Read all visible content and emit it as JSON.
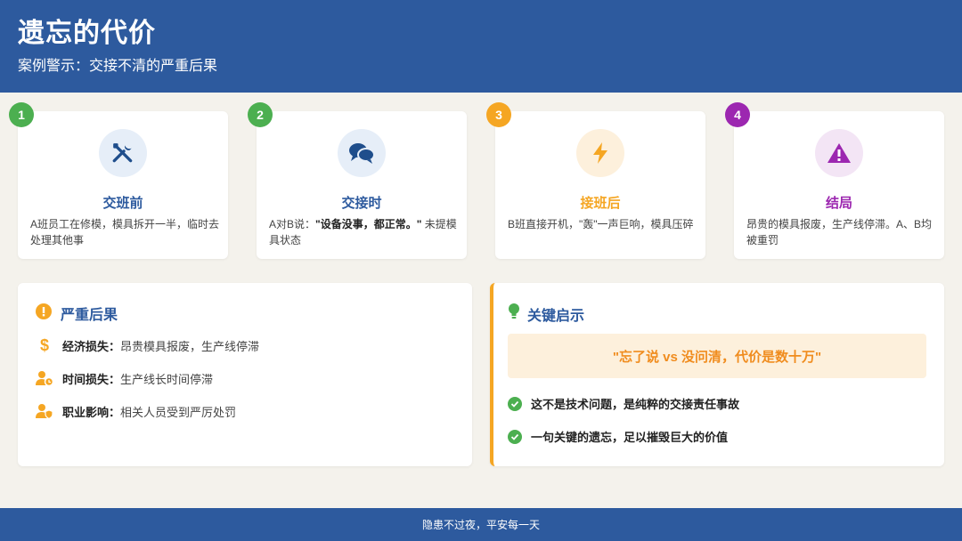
{
  "header": {
    "title": "遗忘的代价",
    "subtitle": "案例警示：交接不清的严重后果"
  },
  "steps": [
    {
      "num": "1",
      "title": "交班前",
      "desc": "A班员工在修模，模具拆开一半，临时去处理其他事",
      "color": "#4caf50",
      "icon": "tools-icon",
      "icon_bg": "#e6eef8"
    },
    {
      "num": "2",
      "title": "交接时",
      "desc_pre": "A对B说：",
      "desc_bold": "\"设备没事，都正常。\"",
      "desc_post": " 未提模具状态",
      "color": "#4caf50",
      "icon": "chat-bubbles-icon",
      "icon_bg": "#e6eef8"
    },
    {
      "num": "3",
      "title": "接班后",
      "desc": "B班直接开机，\"轰\"一声巨响，模具压碎",
      "color": "#f5a623",
      "icon": "lightning-icon",
      "icon_bg": "#fdf0dc"
    },
    {
      "num": "4",
      "title": "结局",
      "desc": "昂贵的模具报废，生产线停滞。A、B均被重罚",
      "color": "#9c27b0",
      "icon": "warning-icon",
      "icon_bg": "#f3e5f5"
    }
  ],
  "consequences": {
    "title": "严重后果",
    "items": [
      {
        "label": "经济损失：",
        "text": "昂贵模具报废，生产线停滞",
        "icon": "dollar-icon"
      },
      {
        "label": "时间损失：",
        "text": "生产线长时间停滞",
        "icon": "user-clock-icon"
      },
      {
        "label": "职业影响：",
        "text": "相关人员受到严厉处罚",
        "icon": "user-shield-icon"
      }
    ]
  },
  "insights": {
    "title": "关键启示",
    "quote": "\"忘了说 vs 没问清，代价是数十万\"",
    "items": [
      "这不是技术问题，是纯粹的交接责任事故",
      "一句关键的遗忘，足以摧毁巨大的价值"
    ]
  },
  "footer": {
    "text": "隐患不过夜，平安每一天"
  },
  "colors": {
    "primary": "#2d5a9e",
    "green": "#4caf50",
    "orange": "#f5a623",
    "purple": "#9c27b0"
  }
}
